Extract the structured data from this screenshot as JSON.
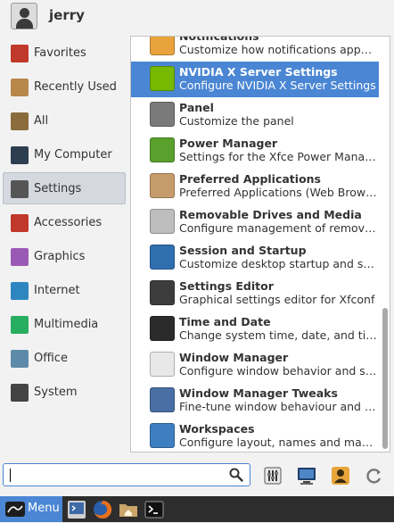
{
  "user": {
    "name": "jerry"
  },
  "categories": [
    {
      "label": "Favorites",
      "icon": "favorites-icon",
      "color": "#c0392b"
    },
    {
      "label": "Recently Used",
      "icon": "recently-used-icon",
      "color": "#b8874a"
    },
    {
      "label": "All",
      "icon": "all-apps-icon",
      "color": "#8a6d3b"
    },
    {
      "label": "My Computer",
      "icon": "computer-icon",
      "color": "#2c3e50"
    },
    {
      "label": "Settings",
      "icon": "settings-icon",
      "color": "#555555",
      "active": true
    },
    {
      "label": "Accessories",
      "icon": "accessories-icon",
      "color": "#c0392b"
    },
    {
      "label": "Graphics",
      "icon": "graphics-icon",
      "color": "#9b59b6"
    },
    {
      "label": "Internet",
      "icon": "internet-icon",
      "color": "#2e86c1"
    },
    {
      "label": "Multimedia",
      "icon": "multimedia-icon",
      "color": "#27ae60"
    },
    {
      "label": "Office",
      "icon": "office-icon",
      "color": "#5d8aa8"
    },
    {
      "label": "System",
      "icon": "system-icon",
      "color": "#444444"
    }
  ],
  "apps": [
    {
      "name": "Notifications",
      "desc": "Customize how notifications appear",
      "icon": "notifications-icon",
      "color": "#e8a33d"
    },
    {
      "name": "NVIDIA X Server Settings",
      "desc": "Configure NVIDIA X Server Settings",
      "icon": "nvidia-icon",
      "color": "#76b900",
      "selected": true
    },
    {
      "name": "Panel",
      "desc": "Customize the panel",
      "icon": "panel-icon",
      "color": "#7a7a7a"
    },
    {
      "name": "Power Manager",
      "desc": "Settings for the Xfce Power Manager",
      "icon": "battery-icon",
      "color": "#5aa02c"
    },
    {
      "name": "Preferred Applications",
      "desc": "Preferred Applications (Web Browser, Mail Reader)",
      "icon": "preferred-apps-icon",
      "color": "#c69c6d"
    },
    {
      "name": "Removable Drives and Media",
      "desc": "Configure management of removable drives",
      "icon": "eject-icon",
      "color": "#bdbdbd"
    },
    {
      "name": "Session and Startup",
      "desc": "Customize desktop startup and splash screen",
      "icon": "session-icon",
      "color": "#2f6fb0"
    },
    {
      "name": "Settings Editor",
      "desc": "Graphical settings editor for Xfconf",
      "icon": "settings-editor-icon",
      "color": "#3c3c3c"
    },
    {
      "name": "Time and Date",
      "desc": "Change system time, date, and timezone",
      "icon": "clock-icon",
      "color": "#2b2b2b"
    },
    {
      "name": "Window Manager",
      "desc": "Configure window behavior and shortcuts",
      "icon": "window-manager-icon",
      "color": "#e8e8e8"
    },
    {
      "name": "Window Manager Tweaks",
      "desc": "Fine-tune window behaviour and effects",
      "icon": "wm-tweaks-icon",
      "color": "#4a6fa5"
    },
    {
      "name": "Workspaces",
      "desc": "Configure layout, names and margins",
      "icon": "workspaces-icon",
      "color": "#3d7fc1"
    }
  ],
  "search": {
    "value": "",
    "icon": "search-icon"
  },
  "toolbar": [
    {
      "icon": "settings-manager-icon",
      "color": "#4a4a4a"
    },
    {
      "icon": "lock-screen-icon",
      "color": "#1f5fa8"
    },
    {
      "icon": "switch-user-icon",
      "color": "#e0a030"
    },
    {
      "icon": "logout-icon",
      "color": "#808080"
    }
  ],
  "panel": {
    "menu_label": "Menu",
    "launchers": [
      {
        "icon": "terminal-emulator-icon",
        "color": "#3e6aa8"
      },
      {
        "icon": "firefox-icon",
        "color": "#e66a1c"
      },
      {
        "icon": "home-folder-icon",
        "color": "#c9a56a"
      },
      {
        "icon": "terminal-icon",
        "color": "#111111"
      }
    ]
  }
}
